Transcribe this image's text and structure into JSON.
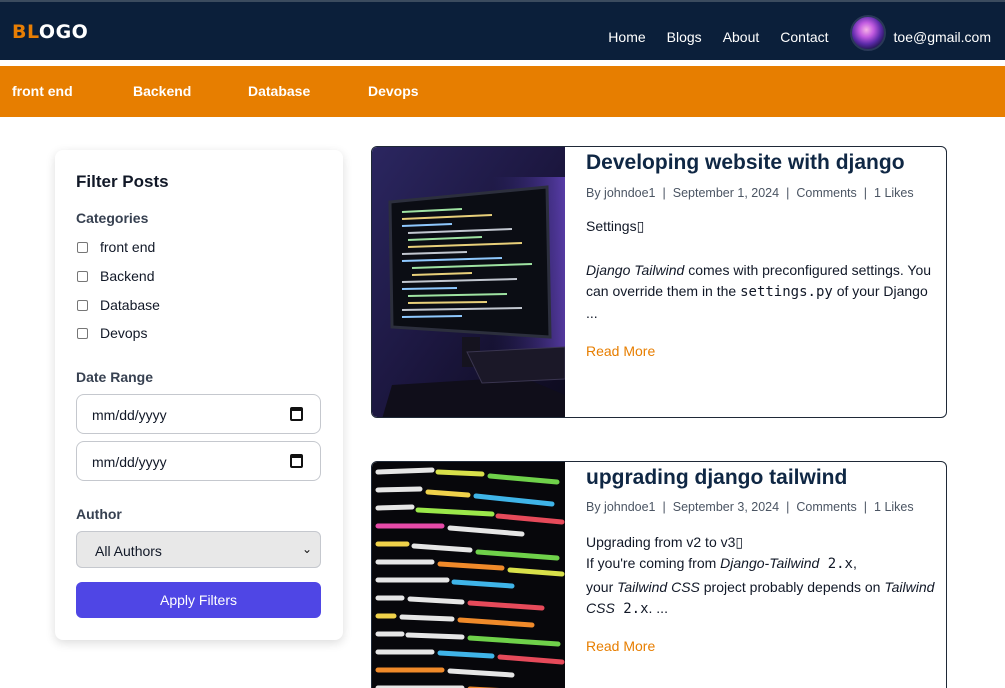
{
  "logo": {
    "part1": "BL",
    "part2": "OGO"
  },
  "nav": {
    "links": [
      "Home",
      "Blogs",
      "About",
      "Contact"
    ],
    "email": "toe@gmail.com"
  },
  "categories": [
    "front end",
    "Backend",
    "Database",
    "Devops"
  ],
  "filter": {
    "title": "Filter Posts",
    "categories_label": "Categories",
    "categories": [
      "front end",
      "Backend",
      "Database",
      "Devops"
    ],
    "date_label": "Date Range",
    "date_placeholder_start": "mm/dd/yyyy",
    "date_placeholder_end": "mm/dd/yyyy",
    "author_label": "Author",
    "author_selected": "All Authors",
    "apply_label": "Apply Filters"
  },
  "posts": [
    {
      "title": "Developing website with django",
      "author": "By johndoe1",
      "date": "September 1, 2024",
      "comments": "Comments",
      "likes": "1 Likes",
      "heading": "Settings▯",
      "p1": "Django Tailwind",
      "p2": " comes with preconfigured settings. You can override them in the ",
      "p3": "settings.py",
      "p4": " of your Django",
      "p5": "...",
      "read_more": "Read More"
    },
    {
      "title": "upgrading django tailwind",
      "author": "By johndoe1",
      "date": "September 3, 2024",
      "comments": "Comments",
      "likes": "1 Likes",
      "l1": "Upgrading from v2 to v3▯",
      "l2a": "If you're coming from ",
      "l2b": "Django-Tailwind",
      "l2c": " 2.x",
      "l2d": ",",
      "l3a": "your ",
      "l3b": "Tailwind CSS",
      "l3c": " project probably depends on ",
      "l3d": "Tailwind CSS",
      "l3e": " 2.x",
      "l3f": ". ...",
      "read_more": "Read More"
    }
  ],
  "colors": {
    "navy": "#0b1f3a",
    "orange": "#e77e00",
    "indigo": "#4f46e5"
  }
}
